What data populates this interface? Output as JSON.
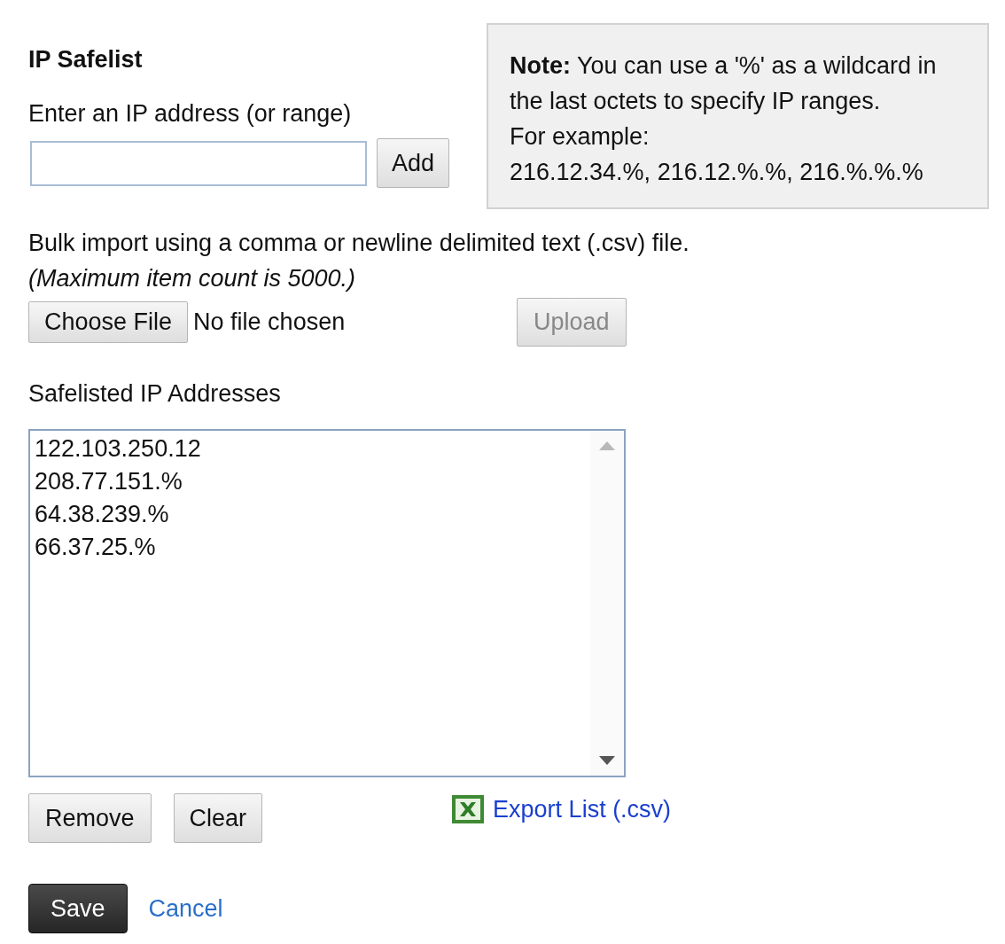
{
  "title": "IP Safelist",
  "ip_field": {
    "label": "Enter an IP address (or range)"
  },
  "add_button": "Add",
  "note": {
    "paragraphs": [
      "**Note:** You can use a '%' as a wildcard in the last octets to specify IP ranges.",
      "For example:",
      "216.12.34.%, 216.12.%.%, 216.%.%.%"
    ]
  },
  "bulk_import": {
    "text": "Bulk import using a comma or newline delimited text (.csv) file.",
    "limit": "(Maximum item count is 5000.)",
    "choose_button": "Choose File",
    "file_status": "No file chosen",
    "upload_button": {
      "label": "Upload",
      "disabled": true
    }
  },
  "safelist": {
    "label": "Safelisted IP Addresses",
    "items": [
      {
        "text": "122.103.250.12",
        "selected": false
      },
      {
        "text": "208.77.151.%",
        "selected": false
      },
      {
        "text": "64.38.239.%",
        "selected": false
      },
      {
        "text": "66.37.25.%",
        "selected": false
      }
    ]
  },
  "remove_button": "Remove",
  "clear_button": "Clear",
  "export_link": "Export List (.csv)",
  "save_button": "Save",
  "cancel_link": "Cancel"
}
